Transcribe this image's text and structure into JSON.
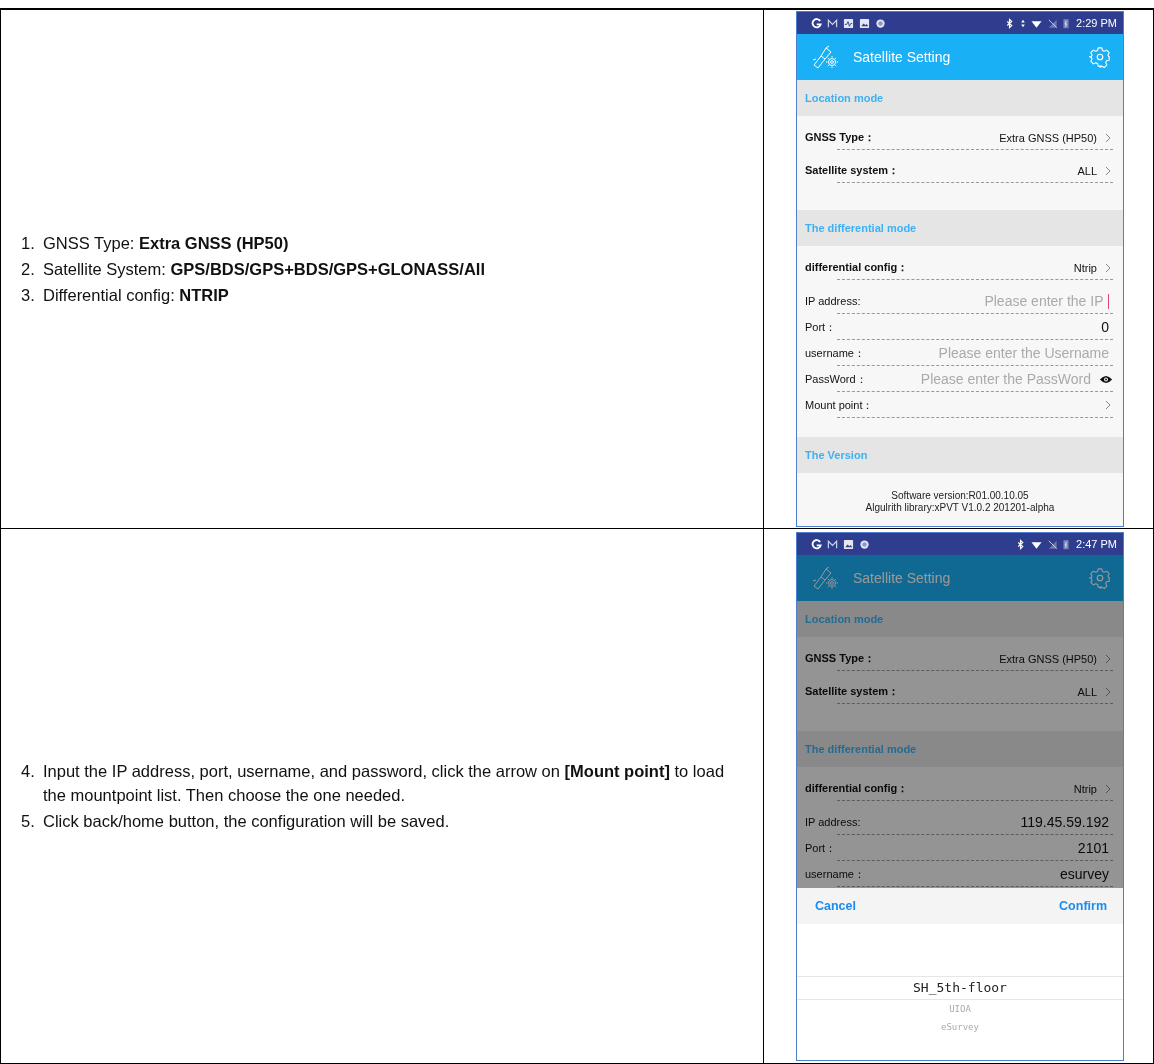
{
  "rows": [
    {
      "steps": [
        {
          "number": "1.",
          "text": "GNSS Type: **Extra GNSS (HP50)**"
        },
        {
          "number": "2.",
          "text": "Satellite System: **GPS/BDS/GPS+BDS/GPS+GLONASS/All**"
        },
        {
          "number": "3.",
          "text": "Differential config: **NTRIP**"
        }
      ],
      "phone": {
        "dimmed": false,
        "notifications": [
          {
            "kind": "google"
          },
          {
            "kind": "mail"
          },
          {
            "kind": "activity"
          },
          {
            "kind": "gallery"
          },
          {
            "kind": "circle"
          }
        ],
        "status_icons": [
          {
            "kind": "bluetooth"
          },
          {
            "kind": "data"
          },
          {
            "kind": "wifi"
          },
          {
            "kind": "no-sim"
          },
          {
            "kind": "battery"
          }
        ],
        "time": "2:29 PM",
        "app_title": "Satellite Setting",
        "sections": [
          {
            "title": "Location mode",
            "rows": [
              {
                "kind": "option",
                "label": "GNSS Type：",
                "value": "Extra GNSS (HP50)"
              },
              {
                "kind": "option",
                "label": "Satellite system：",
                "value": "ALL"
              }
            ]
          },
          {
            "title": "The differential mode",
            "rows": [
              {
                "kind": "option",
                "label": "differential config：",
                "value": "Ntrip"
              },
              {
                "kind": "field",
                "label": "IP address:",
                "placeholder": "Please enter the IP",
                "focused": true
              },
              {
                "kind": "field",
                "label": "Port：",
                "value": "0"
              },
              {
                "kind": "field",
                "label": "username：",
                "placeholder": "Please enter the Username"
              },
              {
                "kind": "field",
                "label": "PassWord：",
                "placeholder": "Please enter the PassWord",
                "secret": true
              },
              {
                "kind": "link",
                "label": "Mount point："
              }
            ]
          },
          {
            "title": "The Version",
            "lines": [
              "Software version:R01.00.10.05",
              "Algulrith library:xPVT V1.0.2 201201-alpha"
            ]
          }
        ]
      }
    },
    {
      "steps": [
        {
          "number": "4.",
          "text": "Input the IP address, port, username, and password, click the arrow on **[Mount point]** to load the mountpoint list. Then choose the one needed."
        },
        {
          "number": "5.",
          "text": "Click back/home button, the configuration will be saved."
        }
      ],
      "phone": {
        "dimmed": true,
        "notifications": [
          {
            "kind": "google"
          },
          {
            "kind": "mail"
          },
          {
            "kind": "gallery"
          },
          {
            "kind": "circle"
          }
        ],
        "status_icons": [
          {
            "kind": "bluetooth"
          },
          {
            "kind": "wifi"
          },
          {
            "kind": "no-sim"
          },
          {
            "kind": "battery"
          }
        ],
        "time": "2:47 PM",
        "app_title": "Satellite Setting",
        "sections": [
          {
            "title": "Location mode",
            "rows": [
              {
                "kind": "option",
                "label": "GNSS Type：",
                "value": "Extra GNSS (HP50)"
              },
              {
                "kind": "option",
                "label": "Satellite system：",
                "value": "ALL"
              }
            ]
          },
          {
            "title": "The differential mode",
            "rows": [
              {
                "kind": "option",
                "label": "differential config：",
                "value": "Ntrip"
              },
              {
                "kind": "field",
                "label": "IP address:",
                "value": "119.45.59.192"
              },
              {
                "kind": "field",
                "label": "Port：",
                "value": "2101"
              },
              {
                "kind": "field",
                "label": "username：",
                "value": "esurvey"
              }
            ]
          }
        ],
        "picker": {
          "cancel": "Cancel",
          "confirm": "Confirm",
          "options": [
            {
              "label": "SH_5th-floor",
              "selected": true
            },
            {
              "label": "UIOA",
              "selected": false
            },
            {
              "label": "eSurvey",
              "selected": false
            }
          ]
        }
      }
    }
  ]
}
